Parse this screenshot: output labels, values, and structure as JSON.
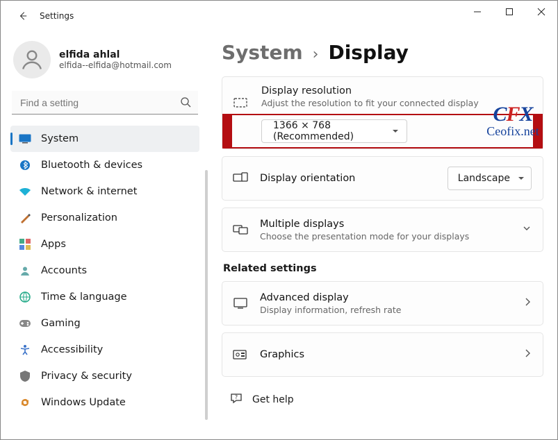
{
  "app": {
    "title": "Settings"
  },
  "profile": {
    "name": "elfida ahlal",
    "email": "elfida--elfida@hotmail.com"
  },
  "search": {
    "placeholder": "Find a setting"
  },
  "sidebar": {
    "items": [
      {
        "label": "System"
      },
      {
        "label": "Bluetooth & devices"
      },
      {
        "label": "Network & internet"
      },
      {
        "label": "Personalization"
      },
      {
        "label": "Apps"
      },
      {
        "label": "Accounts"
      },
      {
        "label": "Time & language"
      },
      {
        "label": "Gaming"
      },
      {
        "label": "Accessibility"
      },
      {
        "label": "Privacy & security"
      },
      {
        "label": "Windows Update"
      }
    ]
  },
  "breadcrumb": {
    "parent": "System",
    "current": "Display"
  },
  "resolution": {
    "title": "Display resolution",
    "sub": "Adjust the resolution to fit your connected display",
    "value": "1366 × 768 (Recommended)"
  },
  "orientation": {
    "title": "Display orientation",
    "value": "Landscape"
  },
  "multiple": {
    "title": "Multiple displays",
    "sub": "Choose the presentation mode for your displays"
  },
  "related": {
    "heading": "Related settings",
    "advanced": {
      "title": "Advanced display",
      "sub": "Display information, refresh rate"
    },
    "graphics": {
      "title": "Graphics"
    }
  },
  "gethelp": "Get help",
  "watermark": {
    "logo_c": "C",
    "logo_f": "F",
    "logo_x": "X",
    "url": "Ceofix.net"
  }
}
